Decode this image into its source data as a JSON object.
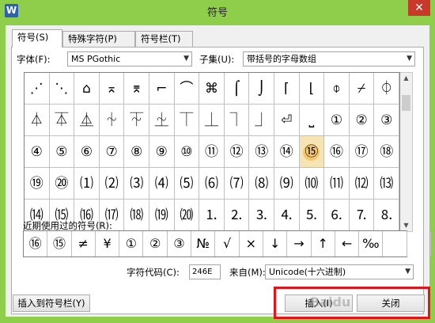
{
  "window": {
    "title": "符号",
    "app_icon": "W",
    "close_glyph": "✕"
  },
  "tabs": [
    {
      "label": "符号(S)"
    },
    {
      "label": "特殊字符(P)"
    },
    {
      "label": "符号栏(T)"
    }
  ],
  "font": {
    "label": "字体(F):",
    "value": "MS PGothic"
  },
  "subset": {
    "label": "子集(U):",
    "value": "带括号的字母数组"
  },
  "symbols": [
    "⋰",
    "⋱",
    "⌂",
    "⌅",
    "⌆",
    "⌐",
    "⌒",
    "⌘",
    "⌠",
    "⌡",
    "⌈",
    "⌊",
    "⌽",
    "⌿",
    "⏀",
    "⏃",
    "⏄",
    "⏅",
    "⏆",
    "⏇",
    "⏈",
    "⏉",
    "⏊",
    "⏋",
    "⏌",
    "⏎",
    "⎵",
    "①",
    "②",
    "③",
    "④",
    "⑤",
    "⑥",
    "⑦",
    "⑧",
    "⑨",
    "⑩",
    "⑪",
    "⑫",
    "⑬",
    "⑭",
    "⑮",
    "⑯",
    "⑰",
    "⑱",
    "⑲",
    "⑳",
    "⑴",
    "⑵",
    "⑶",
    "⑷",
    "⑸",
    "⑹",
    "⑺",
    "⑻",
    "⑼",
    "⑽",
    "⑾",
    "⑿",
    "⒀",
    "⒁",
    "⒂",
    "⒃",
    "⒄",
    "⒅",
    "⒆",
    "⒇",
    "⒈",
    "⒉",
    "⒊",
    "⒋",
    "⒌",
    "⒍",
    "⒎",
    "⒏"
  ],
  "selected_index": 41,
  "recent": {
    "label": "近期使用过的符号(R):",
    "items": [
      "⑯",
      "⑮",
      "≠",
      "¥",
      "①",
      "②",
      "③",
      "№",
      "√",
      "×",
      "↓",
      "→",
      "↑",
      "←",
      "‰",
      "",
      ""
    ]
  },
  "char_code": {
    "label": "字符代码(C):",
    "value": "246E"
  },
  "from": {
    "label": "来自(M):",
    "value": "Unicode(十六进制)"
  },
  "buttons": {
    "insert_to_bar": "插入到符号栏(Y)",
    "insert": "插入(I)",
    "close": "关闭"
  },
  "watermark": "Baidu"
}
